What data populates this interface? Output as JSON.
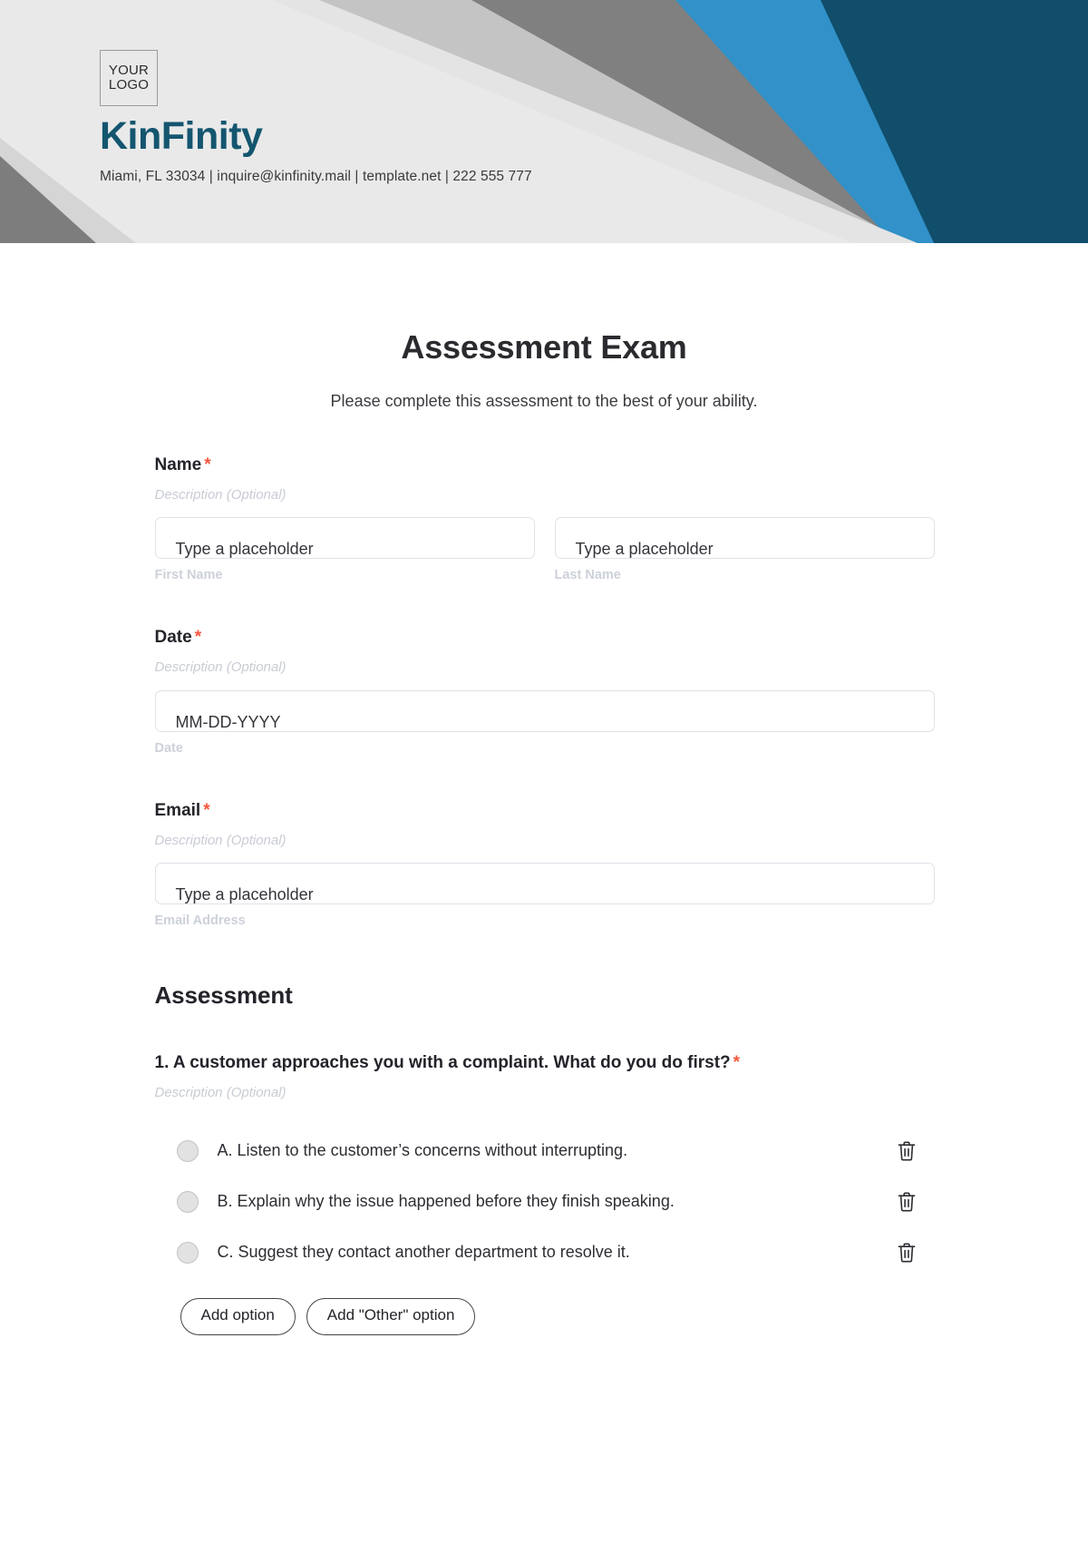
{
  "header": {
    "logo_line1": "YOUR",
    "logo_line2": "LOGO",
    "brand_name": "KinFinity",
    "contact": "Miami, FL 33034 | inquire@kinfinity.mail | template.net | 222 555 777",
    "colors": {
      "background": "#e4e4e4",
      "dark_gray": "#808080",
      "light_gray": "#c4c4c4",
      "blue": "#3191c8",
      "navy": "#104e6b",
      "brand_text": "#14556f"
    }
  },
  "form": {
    "title": "Assessment Exam",
    "subtitle": "Please complete this assessment to the best of your ability.",
    "required_marker": "*",
    "description_placeholder": "Description (Optional)",
    "fields": [
      {
        "label": "Name",
        "required": true,
        "description": "Description (Optional)",
        "inputs": [
          {
            "placeholder": "Type a placeholder",
            "sub_label": "First Name"
          },
          {
            "placeholder": "Type a placeholder",
            "sub_label": "Last Name"
          }
        ]
      },
      {
        "label": "Date",
        "required": true,
        "description": "Description (Optional)",
        "inputs": [
          {
            "placeholder": "MM-DD-YYYY",
            "sub_label": "Date"
          }
        ]
      },
      {
        "label": "Email",
        "required": true,
        "description": "Description (Optional)",
        "inputs": [
          {
            "placeholder": "Type a placeholder",
            "sub_label": "Email Address"
          }
        ]
      }
    ],
    "assessment": {
      "heading": "Assessment",
      "questions": [
        {
          "text": "1. A customer approaches you with a complaint. What do you do first?",
          "required": true,
          "description": "Description (Optional)",
          "options": [
            "A. Listen to the customer’s concerns without interrupting.",
            "B. Explain why the issue happened before they finish speaking.",
            "C. Suggest they contact another department to resolve it."
          ],
          "add_option_label": "Add option",
          "add_other_option_label": "Add \"Other\" option",
          "delete_icon": "trash-icon"
        }
      ]
    }
  }
}
